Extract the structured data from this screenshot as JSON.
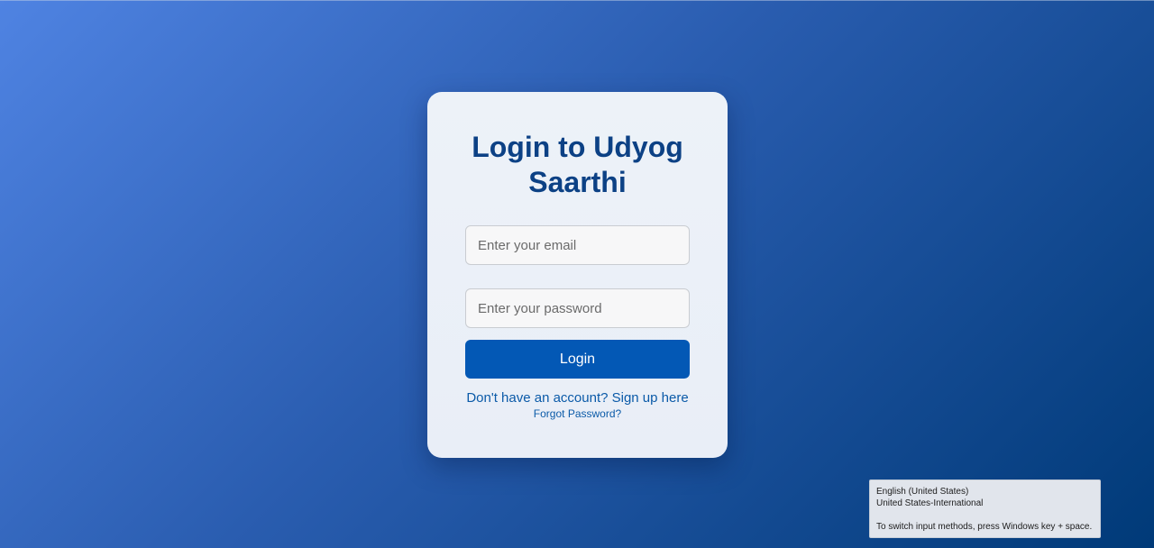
{
  "login_card": {
    "title": "Login to Udyog Saarthi",
    "email_placeholder": "Enter your email",
    "password_placeholder": "Enter your password",
    "login_label": "Login",
    "signup_text": "Don't have an account? Sign up here",
    "forgot_text": "Forgot Password?"
  },
  "ime_tooltip": {
    "language": "English (United States)",
    "layout": "United States-International",
    "hint": "To switch input methods, press Windows key + space."
  },
  "colors": {
    "accent": "#0358b5",
    "title": "#0c4185",
    "link": "#0b5aa8",
    "background_start": "#4f83e2",
    "background_end": "#003a78"
  }
}
